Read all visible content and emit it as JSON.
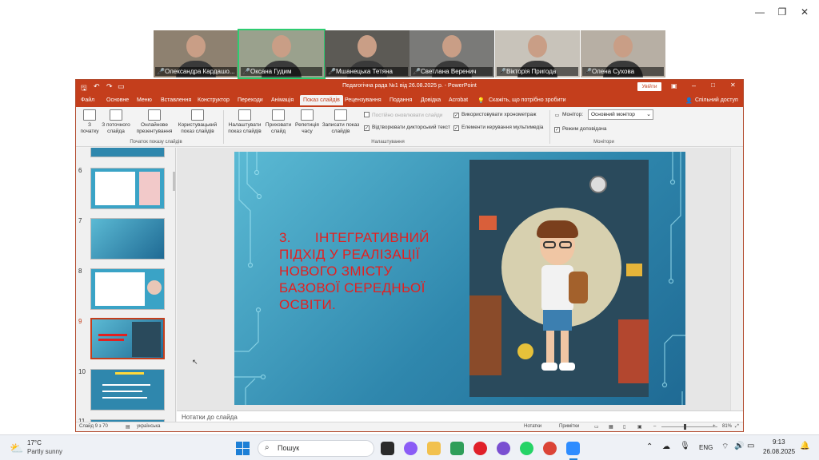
{
  "participants": [
    {
      "name": "Олександра Кардашо...",
      "bg": "#8e8170"
    },
    {
      "name": "Оксана Гудим",
      "bg": "#9aa18d",
      "active": true
    },
    {
      "name": "Мшанецька Тетяна",
      "bg": "#5c5a55"
    },
    {
      "name": "Светлана Веренич",
      "bg": "#7a7a78"
    },
    {
      "name": "Вікторія Пригода",
      "bg": "#c8c3ba"
    },
    {
      "name": "Олена Сухова",
      "bg": "#b7afa4"
    }
  ],
  "ppt": {
    "title": "Педагогічна рада №1 від 26.08.2025 р. - PowerPoint",
    "signin": "Увійти",
    "share": "Спільний доступ",
    "tell_me": "Скажіть, що потрібно зробити",
    "menu": [
      "Файл",
      "Основне",
      "Меню",
      "Вставлення",
      "Конструктор",
      "Переходи",
      "Анімація",
      "Показ слайдів",
      "Рецензування",
      "Подання",
      "Довідка",
      "Acrobat"
    ],
    "active_menu": "Показ слайдів",
    "ribbon": {
      "from_start": "З початку",
      "from_current": "З поточного слайда",
      "online": "Онлайнове презентування",
      "custom": "Користувацький показ слайдів",
      "group_start": "Початок показу слайдів",
      "setup": "Налаштувати показ слайдів",
      "hide": "Приховати слайд",
      "rehearse": "Репетиція часу",
      "record": "Записати показ слайдів",
      "group_setup": "Налаштування",
      "keep_updated": "Постійно оновлювати слайди",
      "play_narration": "Відтворювати дикторський текст",
      "use_timings": "Використовувати хронометраж",
      "media_controls": "Елементи керування мультимедіа",
      "monitor_label": "Монітор:",
      "monitor_value": "Основний монітор",
      "presenter_view": "Режим доповідача",
      "group_monitors": "Монітори"
    },
    "thumb_numbers": [
      "6",
      "7",
      "8",
      "9",
      "10",
      "11"
    ],
    "slide": {
      "title": "3.      ІНТЕГРАТИВНИЙ ПІДХІД У РЕАЛІЗАЦІЇ НОВОГО ЗМІСТУ БАЗОВОЇ СЕРЕДНЬОЇ ОСВІТИ."
    },
    "notes": "Нотатки до слайда",
    "status": {
      "slide": "Слайд 9 з 70",
      "lang": "українська",
      "notes_btn": "Нотатки",
      "comments_btn": "Примітки",
      "zoom": "81%"
    }
  },
  "taskbar": {
    "weather_temp": "17°C",
    "weather_desc": "Partly sunny",
    "search": "Пошук",
    "lang": "ENG",
    "time": "9:13",
    "date": "26.08.2025"
  }
}
